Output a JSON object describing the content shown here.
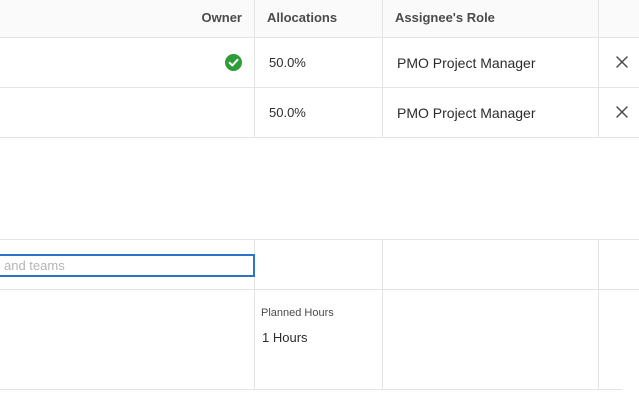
{
  "table": {
    "columns": {
      "owner": "Owner",
      "allocations": "Allocations",
      "assignee_role": "Assignee's Role"
    },
    "rows": [
      {
        "owner_is_owner": true,
        "allocation": "50.0%",
        "role": "PMO Project Manager"
      },
      {
        "owner_is_owner": false,
        "allocation": "50.0%",
        "role": "PMO Project Manager"
      }
    ]
  },
  "add_assignee": {
    "placeholder": "and teams"
  },
  "summary": {
    "planned_label": "Planned Hours",
    "planned_value": "1 Hours"
  },
  "colors": {
    "owner_check": "#2d9d3a",
    "input_focus": "#2d74c4",
    "divider": "#e4e4e4"
  },
  "icons": {
    "owner": "check-circle-icon",
    "remove": "close-icon"
  }
}
